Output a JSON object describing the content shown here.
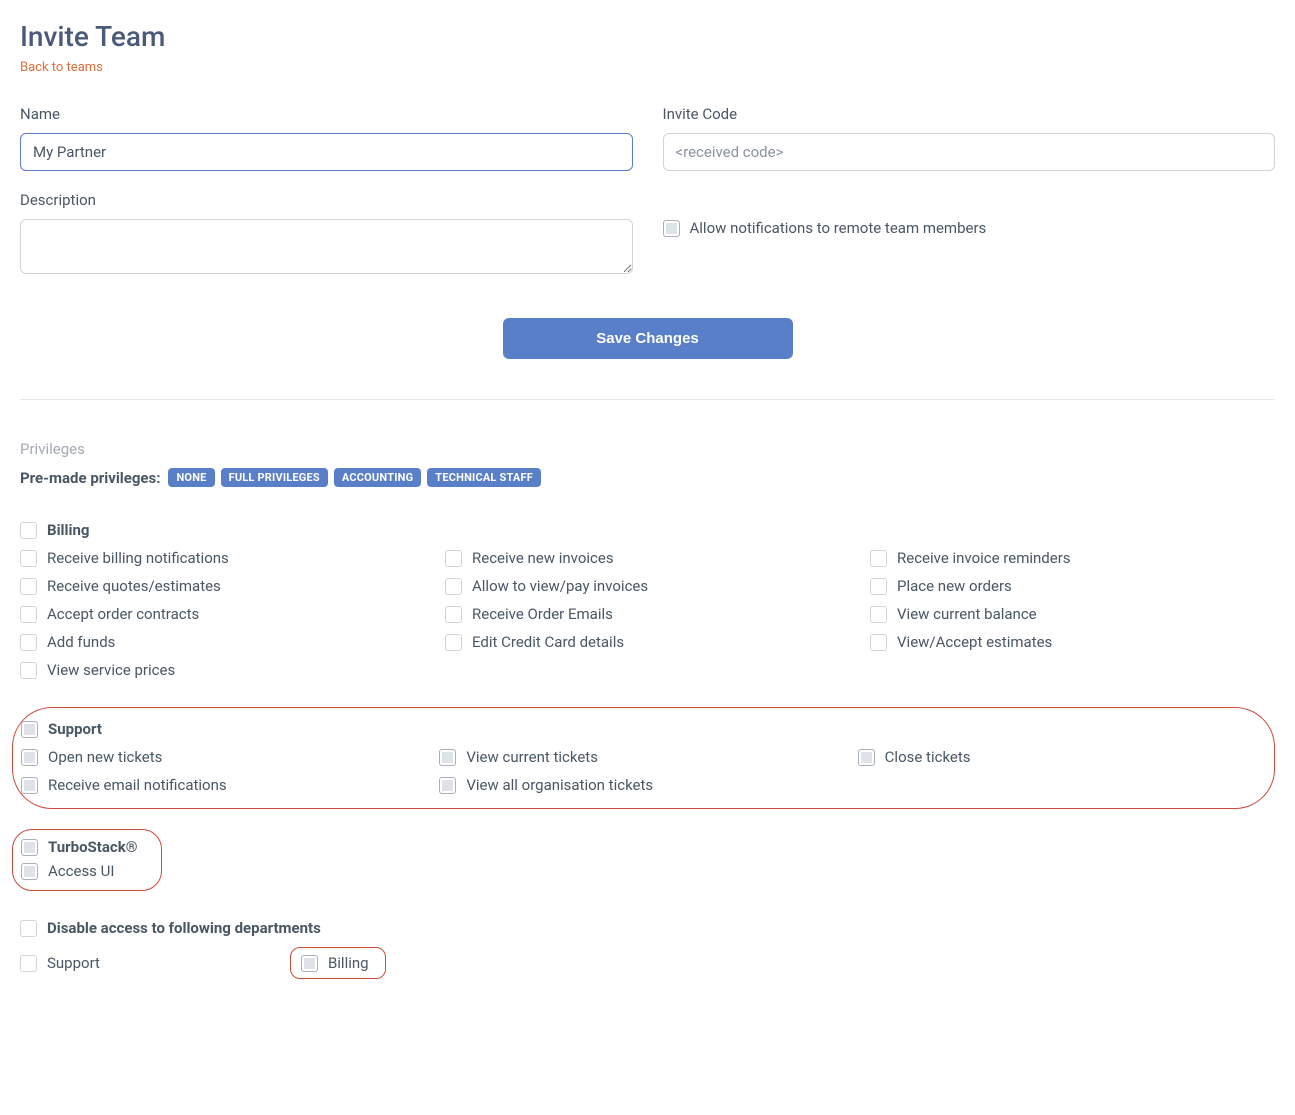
{
  "header": {
    "title": "Invite Team",
    "back_link": "Back to teams"
  },
  "form": {
    "name_label": "Name",
    "name_value": "My Partner",
    "invite_code_label": "Invite Code",
    "invite_code_placeholder": "<received code>",
    "description_label": "Description",
    "description_value": "",
    "allow_notifications_label": "Allow notifications to remote team members",
    "save_button": "Save Changes"
  },
  "privileges": {
    "section_title": "Privileges",
    "premade_label": "Pre-made privileges:",
    "tags": [
      "NONE",
      "FULL PRIVILEGES",
      "ACCOUNTING",
      "TECHNICAL STAFF"
    ],
    "billing": {
      "title": "Billing",
      "items": [
        "Receive billing notifications",
        "Receive new invoices",
        "Receive invoice reminders",
        "Receive quotes/estimates",
        "Allow to view/pay invoices",
        "Place new orders",
        "Accept order contracts",
        "Receive Order Emails",
        "View current balance",
        "Add funds",
        "Edit Credit Card details",
        "View/Accept estimates",
        "View service prices"
      ]
    },
    "support": {
      "title": "Support",
      "items": [
        "Open new tickets",
        "View current tickets",
        "Close tickets",
        "Receive email notifications",
        "View all organisation tickets"
      ]
    },
    "turbostack": {
      "title": "TurboStack®",
      "items": [
        "Access UI"
      ]
    },
    "disable_departments": {
      "title": "Disable access to following departments",
      "items": [
        "Support",
        "Billing"
      ]
    }
  }
}
